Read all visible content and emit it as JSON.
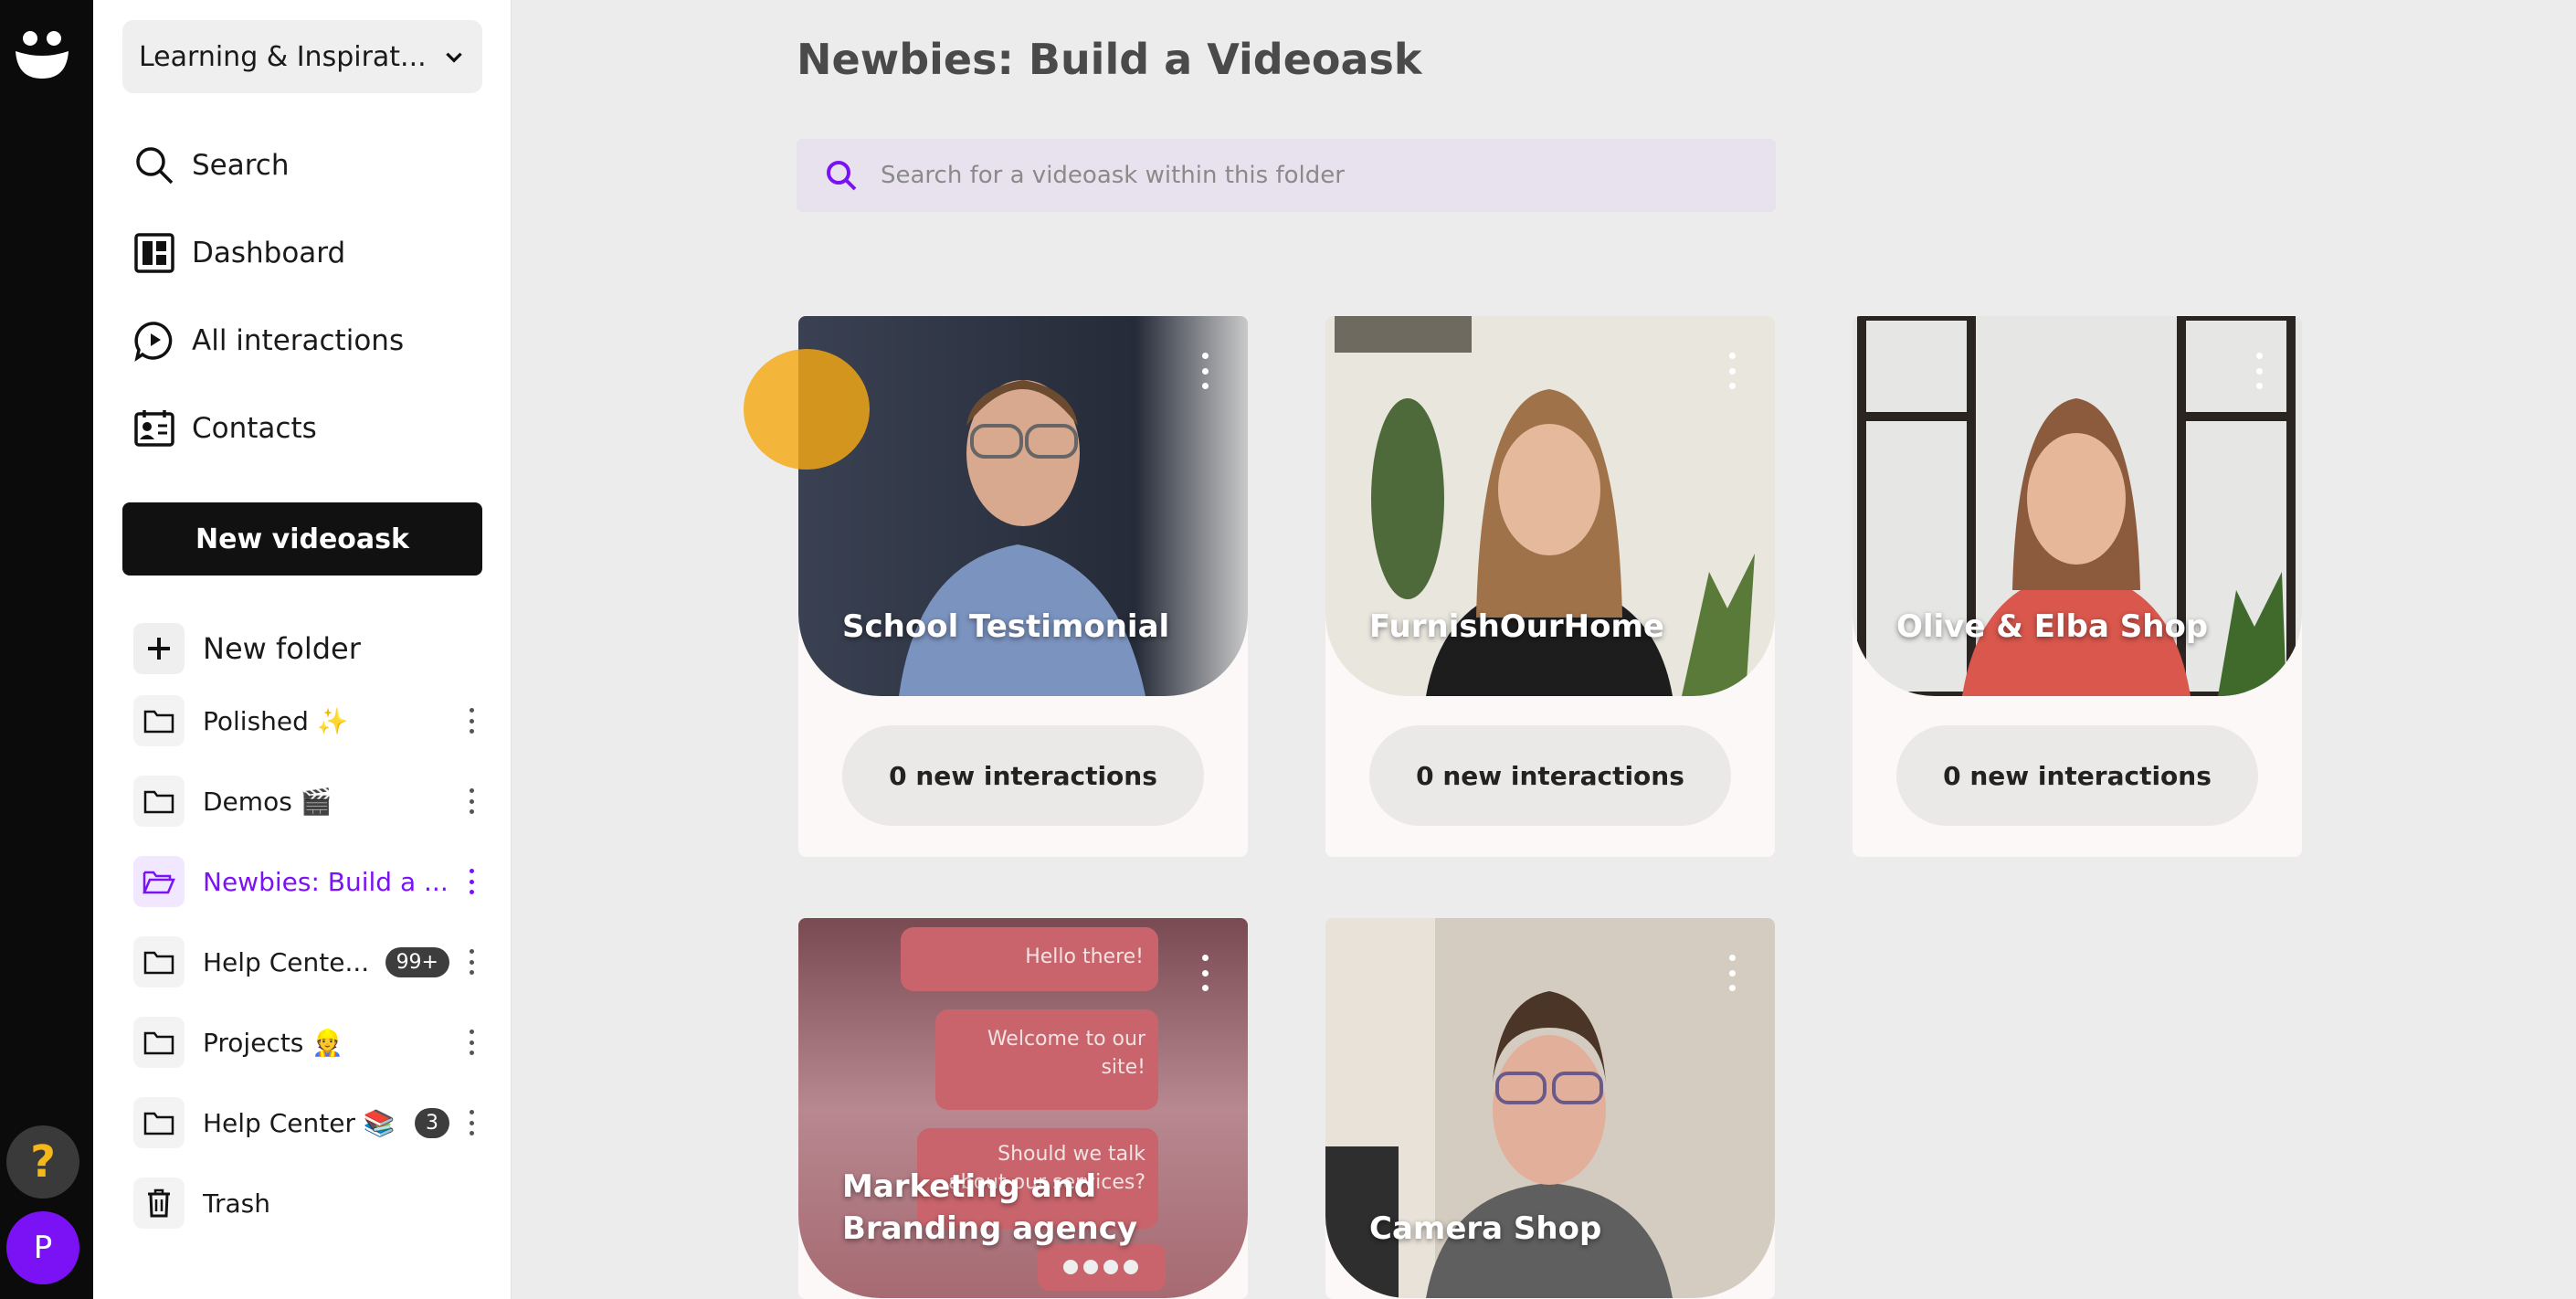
{
  "workspace": {
    "name": "Learning & Inspirat..."
  },
  "nav": {
    "search": "Search",
    "dashboard": "Dashboard",
    "all_interactions": "All interactions",
    "contacts": "Contacts"
  },
  "new_videoask_label": "New videoask",
  "new_folder_label": "New folder",
  "folders": [
    {
      "name": "Polished ✨",
      "badge": "",
      "active": false
    },
    {
      "name": "Demos 🎬",
      "badge": "",
      "active": false
    },
    {
      "name": "Newbies: Build a ...",
      "badge": "",
      "active": true
    },
    {
      "name": "Help Cente...",
      "badge": "99+",
      "active": false
    },
    {
      "name": "Projects 👷",
      "badge": "",
      "active": false
    },
    {
      "name": "Help Center 📚",
      "badge": "3",
      "active": false
    }
  ],
  "trash_label": "Trash",
  "rail": {
    "help_glyph": "?",
    "avatar_initial": "P"
  },
  "main": {
    "title": "Newbies: Build a Videoask",
    "search_placeholder": "Search for a videoask within this folder"
  },
  "cards": [
    {
      "title": "School Testimonial",
      "interactions": "0 new interactions"
    },
    {
      "title": "FurnishOurHome",
      "interactions": "0 new interactions"
    },
    {
      "title": "Olive & Elba Shop",
      "interactions": "0 new interactions"
    },
    {
      "title": "Marketing and Branding agency",
      "interactions": ""
    },
    {
      "title": "Camera Shop",
      "interactions": ""
    }
  ],
  "card4_bubbles": [
    "Hello there!",
    "Welcome to our site!",
    "Should we talk about our services?"
  ],
  "colors": {
    "accent": "#7a12f5",
    "help": "#f5b719",
    "sidebar_bg": "#ffffff",
    "rail_bg": "#0b0b0b"
  }
}
